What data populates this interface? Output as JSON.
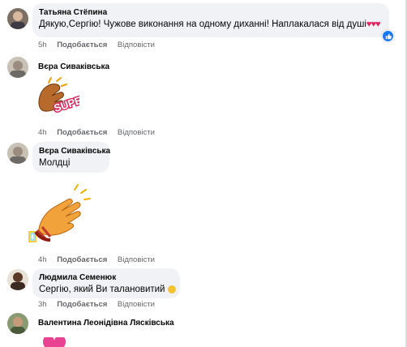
{
  "comments": [
    {
      "author": "Татьяна Стёпина",
      "text": "Дякую,Сергію! Чужове виконання на одному диханні! Наплакалася від душі",
      "time": "5h",
      "like_label": "Подобається",
      "reply_label": "Відповісти",
      "reaction": "like",
      "emoji_suffix": "broken-heart x3"
    },
    {
      "author": "Вєра Сиваківська",
      "sticker": "clapping-hands-super-sticker",
      "sticker_text": "SUPER!",
      "time": "4h",
      "like_label": "Подобається",
      "reply_label": "Відповісти"
    },
    {
      "author": "Вєра Сиваківська",
      "text": "Молдці",
      "sticker": "clapping-hands-sticker",
      "time": "4h",
      "like_label": "Подобається",
      "reply_label": "Відповісти"
    },
    {
      "author": "Людмила Семенюк",
      "text": "Сергію, який Ви талановитий",
      "emoji_suffix": "clapping-hands",
      "time": "3h",
      "like_label": "Подобається",
      "reply_label": "Відповісти"
    },
    {
      "author": "Валентина Леонідівна Лясківська",
      "sticker": "heart-sticker"
    }
  ],
  "colors": {
    "bubble": "#f0f2f5",
    "meta_text": "#65676b",
    "like_blue": "#1877f2",
    "heart_red": "#e0245e"
  }
}
